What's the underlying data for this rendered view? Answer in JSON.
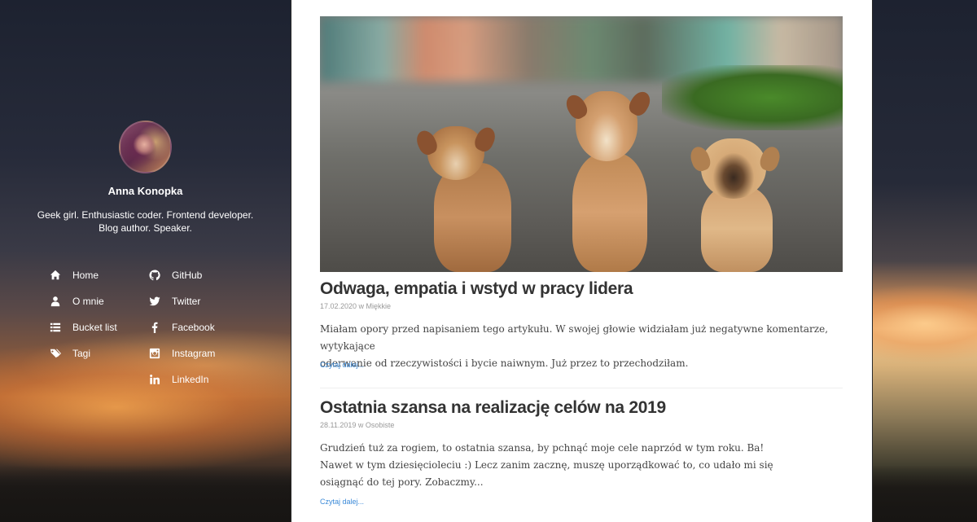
{
  "sidebar": {
    "author": "Anna Konopka",
    "bio": "Geek girl. Enthusiastic coder. Frontend developer. Blog author. Speaker.",
    "nav_left": [
      {
        "label": "Home",
        "icon": "home-icon"
      },
      {
        "label": "O mnie",
        "icon": "user-icon"
      },
      {
        "label": "Bucket list",
        "icon": "list-icon"
      },
      {
        "label": "Tagi",
        "icon": "tags-icon"
      }
    ],
    "nav_right": [
      {
        "label": "GitHub",
        "icon": "github-icon"
      },
      {
        "label": "Twitter",
        "icon": "twitter-icon"
      },
      {
        "label": "Facebook",
        "icon": "facebook-icon"
      },
      {
        "label": "Instagram",
        "icon": "instagram-icon"
      },
      {
        "label": "LinkedIn",
        "icon": "linkedin-icon"
      }
    ]
  },
  "posts": [
    {
      "title": "Odwaga, empatia i wstyd w pracy lidera",
      "meta": "17.02.2020 w Miękkie",
      "excerpt_line1": "Miałam opory przed napisaniem tego artykułu. W swojej głowie widziałam już negatywne komentarze, wytykające",
      "excerpt_line2": "oderwanie od rzeczywistości i bycie naiwnym. Już przez to przechodziłam.",
      "read_more": "Czytaj dalej..."
    },
    {
      "title": "Ostatnia szansa na realizację celów na 2019",
      "meta": "28.11.2019 w Osobiste",
      "excerpt_line1": "Grudzień tuż za rogiem, to ostatnia szansa, by pchnąć moje cele naprzód w tym roku. Ba!",
      "excerpt_line2": "Nawet w tym dziesięcioleciu :) Lecz zanim zacznę, muszę uporządkować to, co udało mi się",
      "excerpt_line3": "osiągnąć do tej pory. Zobaczmy...",
      "read_more": "Czytaj dalej..."
    }
  ],
  "colors": {
    "link": "#3b8ad8",
    "title": "#333333",
    "meta": "#999999"
  }
}
